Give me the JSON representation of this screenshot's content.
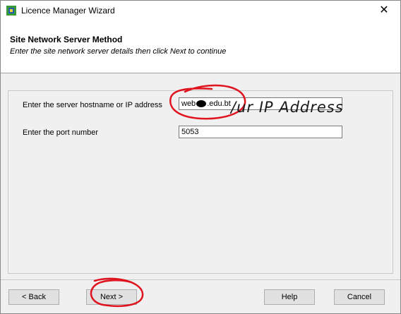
{
  "window": {
    "title": "Licence Manager Wizard",
    "close_glyph": "✕"
  },
  "header": {
    "title": "Site Network Server Method",
    "subtitle": "Enter the site network server details then click Next to continue"
  },
  "form": {
    "hostname_label": "Enter the server hostname or IP address",
    "hostname_value": "web",
    "hostname_suffix": ".edu.bt",
    "port_label": "Enter the port number",
    "port_value": "5053"
  },
  "annotation": {
    "handwritten_note": "/ur IP Address"
  },
  "buttons": {
    "back": "< Back",
    "next": "Next >",
    "help": "Help",
    "cancel": "Cancel"
  },
  "colors": {
    "annotation_red": "#e0141e",
    "header_bg": "#ffffff",
    "dialog_bg": "#f0f0f0"
  }
}
